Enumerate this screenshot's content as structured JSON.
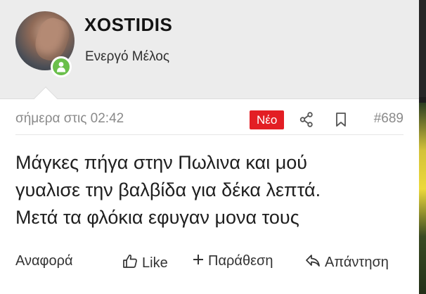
{
  "member": {
    "username": "XOSTIDIS",
    "title": "Ενεργό Μέλος",
    "avatar_icon": "user-avatar",
    "online_icon": "user-online-icon",
    "online_color": "#6abf4b"
  },
  "post": {
    "date": "σήμερα στις 02:42",
    "new_badge": "Νέο",
    "new_badge_color": "#e31e24",
    "share_icon": "share-icon",
    "bookmark_icon": "bookmark-icon",
    "number": "#689",
    "message_lines": [
      "Μάγκες πήγα στην Πωλινα και μού",
      "γυαλισε την βαλβίδα για δέκα λεπτά.",
      "Μετά τα φλόκια εφυγαν μονα τους"
    ]
  },
  "actions": {
    "report": "Αναφορά",
    "like": "Like",
    "quote": "Παράθεση",
    "reply": "Απάντηση"
  }
}
